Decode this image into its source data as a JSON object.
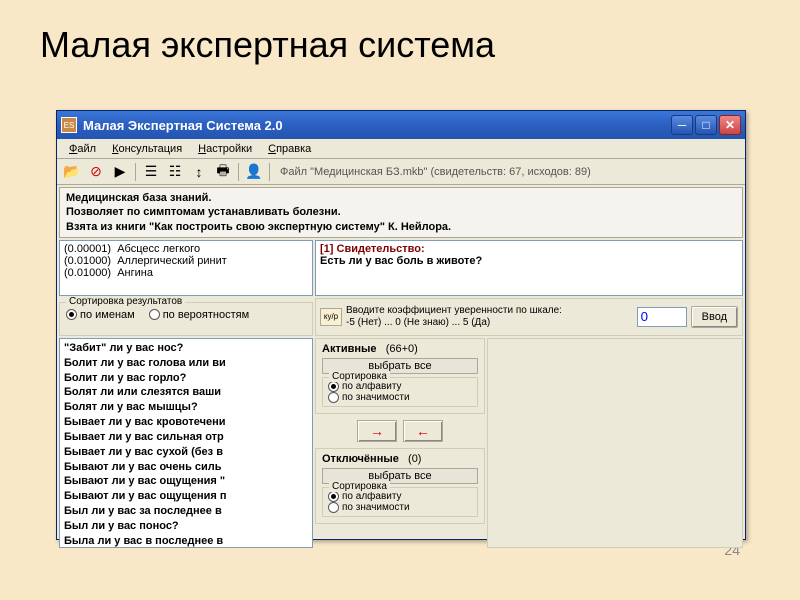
{
  "slide": {
    "title": "Малая экспертная система",
    "page": "24"
  },
  "window": {
    "title": "Малая Экспертная Система 2.0",
    "menu": {
      "file": "Файл",
      "consult": "Консультация",
      "settings": "Настройки",
      "help": "Справка"
    },
    "toolbar_status": "Файл  \"Медицинская БЗ.mkb\"  (свидетельств: 67, исходов: 89)",
    "desc": {
      "l1": "Медицинская база знаний.",
      "l2": "Позволяет по симптомам устанавливать болезни.",
      "l3": "Взята из книги \"Как построить свою экспертную систему\" К. Нейлора."
    },
    "results": [
      {
        "p": "(0.00001)",
        "name": "Абсцесс легкого"
      },
      {
        "p": "(0.01000)",
        "name": "Аллергический ринит"
      },
      {
        "p": "(0.01000)",
        "name": "Ангина"
      }
    ],
    "question": {
      "header": "[1] Свидетельство:",
      "text": "Есть ли у вас боль в животе?"
    },
    "sort_results": {
      "title": "Сортировка результатов",
      "by_name": "по именам",
      "by_prob": "по вероятностям"
    },
    "coeff": {
      "label1": "Вводите коэффициент уверенности по шкале:",
      "label2": "-5 (Нет) ... 0 (Не знаю) ... 5 (Да)",
      "value": "0",
      "submit": "Ввод"
    },
    "symptoms": [
      "\"Забит\" ли у вас нос?",
      "Болит ли у вас голова или ви",
      "Болит ли у вас горло?",
      "Болят ли или слезятся ваши",
      "Болят ли у вас мышцы?",
      "Бывает ли у вас кровотечени",
      "Бывает ли у вас сильная отр",
      "Бывает ли у вас сухой (без в",
      "Бывают ли у вас очень силь",
      "Бывают ли у вас ощущения \"",
      "Бывают ли у вас ощущения п",
      "Был ли у вас за последнее в",
      "Был ли у вас понос?",
      "Была ли у вас в последнее в"
    ],
    "active": {
      "title": "Активные",
      "count": "(66+0)",
      "select_all": "выбрать все",
      "sort_title": "Сортировка",
      "by_alpha": "по алфавиту",
      "by_sig": "по значимости"
    },
    "disabled": {
      "title": "Отключённые",
      "count": "(0)",
      "select_all": "выбрать все",
      "sort_title": "Сортировка",
      "by_alpha": "по алфавиту",
      "by_sig": "по значимости"
    }
  }
}
